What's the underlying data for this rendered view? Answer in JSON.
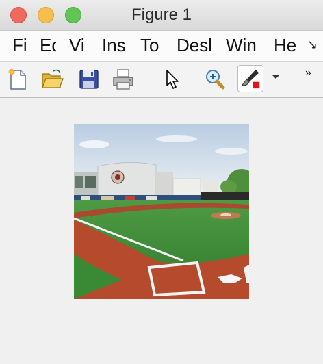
{
  "window": {
    "title": "Figure 1"
  },
  "menu": {
    "items": [
      {
        "label": "Fi"
      },
      {
        "label": "Ec"
      },
      {
        "label": "Vi"
      },
      {
        "label": "Ins"
      },
      {
        "label": "To"
      },
      {
        "label": "Desl"
      },
      {
        "label": "Win"
      },
      {
        "label": "He"
      }
    ],
    "overflow_glyph": "↘"
  },
  "toolbar": {
    "tools": [
      {
        "icon": "new-figure-icon"
      },
      {
        "icon": "open-folder-icon"
      },
      {
        "icon": "save-icon"
      },
      {
        "icon": "print-icon"
      },
      {
        "icon": "pointer-icon"
      },
      {
        "icon": "zoom-in-icon"
      },
      {
        "icon": "brush-icon"
      }
    ],
    "overflow_glyph": "»"
  },
  "colors": {
    "titlebar": "#dcdcdc",
    "close": "#ee6a5f",
    "minimize": "#f5bf4f",
    "maximize": "#61c554",
    "infield_dirt": "#b54a2c",
    "grass": "#3f8a3a",
    "sky": "#d7e3ee"
  },
  "figure": {
    "content": "baseball field photo"
  }
}
